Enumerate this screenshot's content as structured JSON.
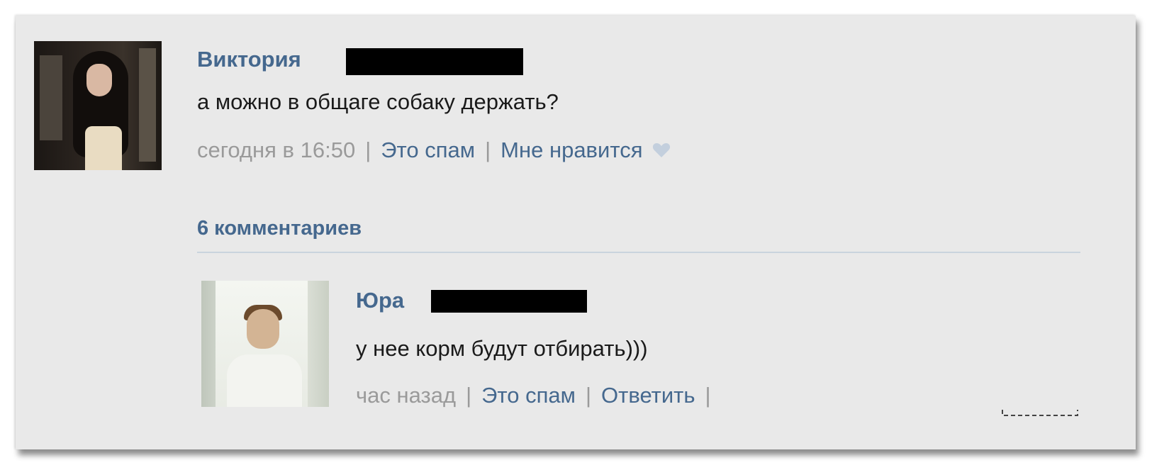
{
  "post": {
    "author": "Виктория",
    "text": "а можно в общаге собаку держать?",
    "time": "сегодня в 16:50",
    "separator": "|",
    "spam_label": "Это спам",
    "like_label": "Мне нравится",
    "like_icon": "heart-icon"
  },
  "comments": {
    "count_label": "6 комментариев",
    "items": [
      {
        "author": "Юра",
        "text": "у нее корм будут отбирать)))",
        "time": "час назад",
        "separator": "|",
        "spam_label": "Это спам",
        "reply_label": "Ответить"
      }
    ]
  },
  "colors": {
    "link": "#45688e",
    "meta_gray": "#9a9a9a",
    "background": "#e9e9e9",
    "redaction": "#000000"
  }
}
